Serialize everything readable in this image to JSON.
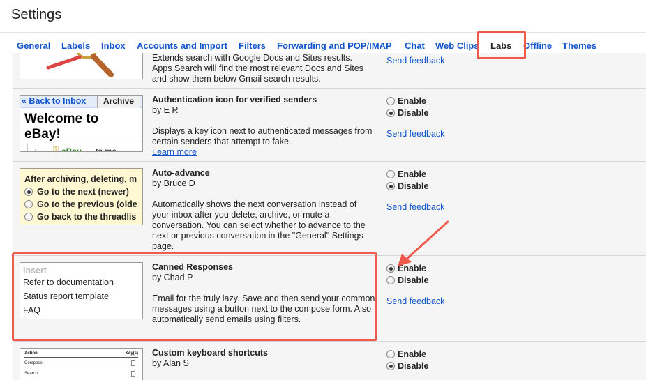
{
  "header": {
    "title": "Settings"
  },
  "tabs": [
    {
      "label": "General"
    },
    {
      "label": "Labels"
    },
    {
      "label": "Inbox"
    },
    {
      "label": "Accounts and Import"
    },
    {
      "label": "Filters"
    },
    {
      "label": "Forwarding and POP/IMAP"
    },
    {
      "label": "Chat"
    },
    {
      "label": "Web Clips"
    },
    {
      "label": "Labs"
    },
    {
      "label": "Offline"
    },
    {
      "label": "Themes"
    }
  ],
  "colors": {
    "link": "#1155cc",
    "highlight": "#ef5a4a",
    "accent_yellow": "#fff8d2"
  },
  "labs": {
    "search": {
      "desc_lines": [
        "Extends search with Google Docs and Sites results.",
        "Apps Search will find the most relevant Docs and Sites",
        "and show them below Gmail search results."
      ],
      "feedback": "Send feedback"
    },
    "auth": {
      "title": "Authentication icon for verified senders",
      "author": "by E R",
      "desc": "Displays a key icon next to authenticated messages from certain senders that attempt to fake.",
      "learn_more": "Learn more",
      "enable": "Enable",
      "disable": "Disable",
      "selected": "Disable",
      "feedback": "Send feedback",
      "thumb": {
        "back": "« Back to Inbox",
        "archive": "Archive",
        "heading": "Welcome to eBay!",
        "from": "eBay",
        "to": "to me"
      }
    },
    "autoadvance": {
      "title": "Auto-advance",
      "author": "by Bruce D",
      "desc": "Automatically shows the next conversation instead of your inbox after you delete, archive, or mute a conversation. You can select whether to advance to the next or previous conversation in the \"General\" Settings page.",
      "enable": "Enable",
      "disable": "Disable",
      "selected": "Disable",
      "feedback": "Send feedback",
      "thumb": {
        "heading": "After archiving, deleting, m",
        "opt1": "Go to the next (newer)",
        "opt2": "Go to the previous (olde",
        "opt3": "Go back to the threadlis"
      }
    },
    "canned": {
      "title": "Canned Responses",
      "author": "by Chad P",
      "desc": "Email for the truly lazy. Save and then send your common messages using a button next to the compose form. Also automatically send emails using filters.",
      "enable": "Enable",
      "disable": "Disable",
      "selected": "Enable",
      "feedback": "Send feedback",
      "thumb": {
        "insert": "Insert",
        "item1": "Refer to documentation",
        "item2": "Status report template",
        "item3": "FAQ"
      }
    },
    "shortcuts": {
      "title": "Custom keyboard shortcuts",
      "author": "by Alan S",
      "enable": "Enable",
      "disable": "Disable",
      "selected": "Disable",
      "thumb": {
        "action": "Action",
        "keys": "Key(s)",
        "compose": "Compose",
        "search": "Search",
        "k1": "c",
        "k2": "/"
      }
    }
  }
}
